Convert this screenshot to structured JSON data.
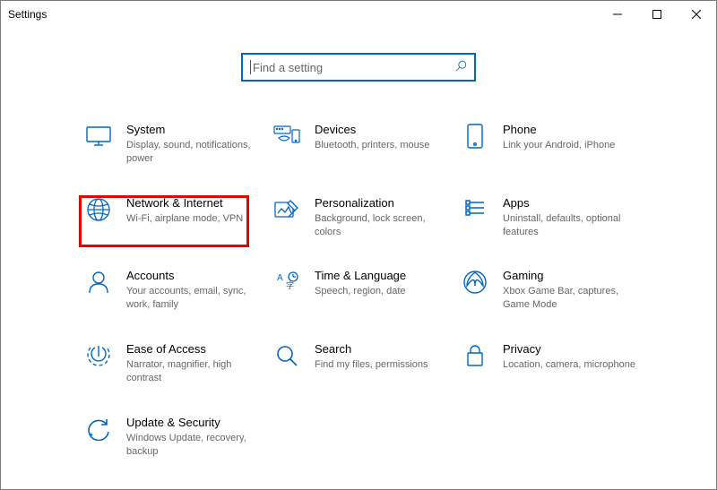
{
  "window": {
    "title": "Settings"
  },
  "search": {
    "placeholder": "Find a setting"
  },
  "highlight_index": 3,
  "tiles": [
    {
      "title": "System",
      "desc": "Display, sound, notifications, power",
      "icon": "system"
    },
    {
      "title": "Devices",
      "desc": "Bluetooth, printers, mouse",
      "icon": "devices"
    },
    {
      "title": "Phone",
      "desc": "Link your Android, iPhone",
      "icon": "phone"
    },
    {
      "title": "Network & Internet",
      "desc": "Wi-Fi, airplane mode, VPN",
      "icon": "network"
    },
    {
      "title": "Personalization",
      "desc": "Background, lock screen, colors",
      "icon": "personalization"
    },
    {
      "title": "Apps",
      "desc": "Uninstall, defaults, optional features",
      "icon": "apps"
    },
    {
      "title": "Accounts",
      "desc": "Your accounts, email, sync, work, family",
      "icon": "accounts"
    },
    {
      "title": "Time & Language",
      "desc": "Speech, region, date",
      "icon": "time"
    },
    {
      "title": "Gaming",
      "desc": "Xbox Game Bar, captures, Game Mode",
      "icon": "gaming"
    },
    {
      "title": "Ease of Access",
      "desc": "Narrator, magnifier, high contrast",
      "icon": "ease"
    },
    {
      "title": "Search",
      "desc": "Find my files, permissions",
      "icon": "search"
    },
    {
      "title": "Privacy",
      "desc": "Location, camera, microphone",
      "icon": "privacy"
    },
    {
      "title": "Update & Security",
      "desc": "Windows Update, recovery, backup",
      "icon": "update"
    }
  ]
}
